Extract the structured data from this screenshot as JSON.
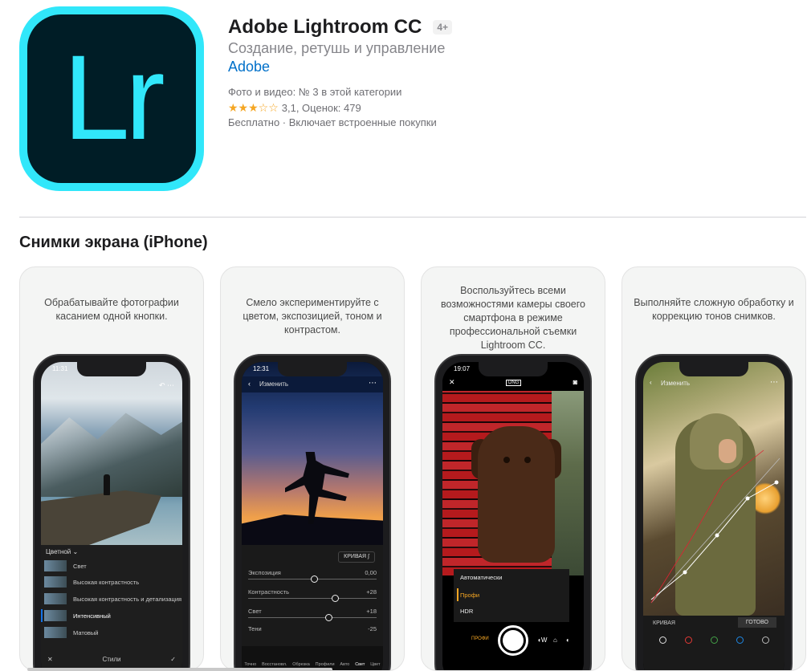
{
  "app": {
    "icon_letters": "Lr",
    "title": "Adobe Lightroom CC",
    "age_rating": "4+",
    "subtitle": "Создание, ретушь и управление",
    "developer": "Adobe",
    "rank": "Фото и видео: № 3 в этой категории",
    "stars": "★★★☆☆",
    "rating_text": "3,1, Оценок: 479",
    "price": "Бесплатно · Включает встроенные покупки",
    "accent_color": "#31e7fa",
    "rating": 3.1
  },
  "screenshots": {
    "section_title": "Снимки экрана (iPhone)",
    "cards": [
      {
        "caption": "Обрабатывайте фотографии касанием одной кнопки.",
        "time": "11:31",
        "dropdown": "Цветной",
        "presets": [
          "Свет",
          "Высокая контрастность",
          "Высокая контрастность и детализация",
          "Интенсивный",
          "Матовый"
        ],
        "bottom_label": "Стили"
      },
      {
        "caption": "Смело экспериментируйте с цветом, экспозицией, тоном и контрастом.",
        "time": "12:31",
        "edit_label": "Изменить",
        "curve_button": "КРИВАЯ",
        "sliders": [
          {
            "name": "Экспозиция",
            "value": "0,00"
          },
          {
            "name": "Контрастность",
            "value": "+28"
          },
          {
            "name": "Свет",
            "value": "+18"
          },
          {
            "name": "Тени",
            "value": "-25"
          }
        ],
        "tools": [
          "Точно",
          "Восстановл.",
          "Обрезка",
          "Профили",
          "Авто",
          "Свет",
          "Цвет"
        ]
      },
      {
        "caption": "Воспользуйтесь всеми возможностями камеры своего смартфона в режиме профессиональной съемки Lightroom CC.",
        "time": "19:07",
        "format_badge": "DNG",
        "modes": [
          "Автоматически",
          "Профи",
          "HDR"
        ],
        "mode_label": "ПРОФИ"
      },
      {
        "caption": "Выполняйте сложную обработку и коррекцию тонов снимков.",
        "edit_label": "Изменить",
        "curve_label": "КРИВАЯ",
        "done_label": "ГОТОВО",
        "channel_colors": [
          "#e0e0e0",
          "#e53935",
          "#43a047",
          "#1e88e5",
          "#bbbbbb"
        ]
      }
    ]
  }
}
